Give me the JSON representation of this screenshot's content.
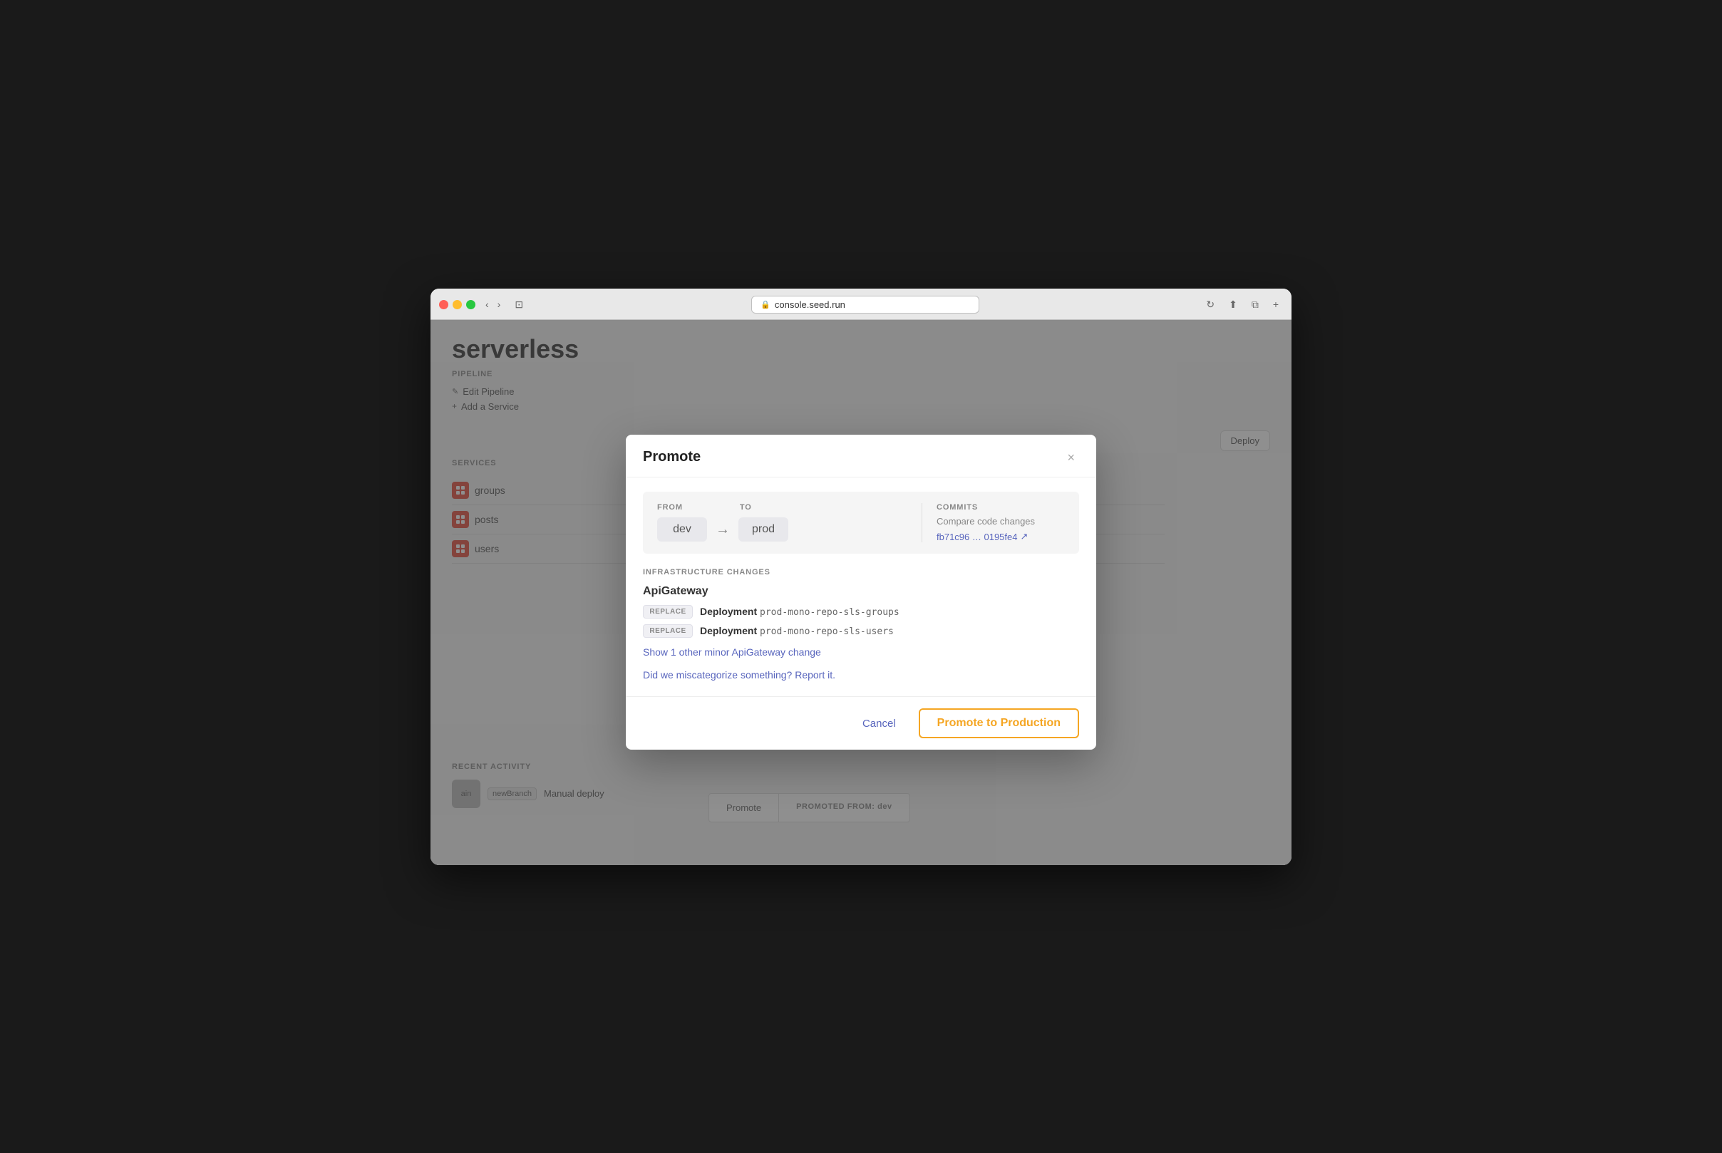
{
  "browser": {
    "url": "console.seed.run",
    "reload_title": "Reload page"
  },
  "background": {
    "page_title": "serverless",
    "pipeline_section": "PIPELINE",
    "edit_pipeline": "Edit Pipeline",
    "add_service": "Add a Service",
    "services_section": "SERVICES",
    "services": [
      {
        "name": "groups"
      },
      {
        "name": "posts"
      },
      {
        "name": "users"
      }
    ],
    "deploy_button": "Deploy",
    "recent_activity_section": "RECENT ACTIVITY",
    "activity_badge": "newBranch",
    "activity_text": "Manual deploy",
    "promoted_from_label": "PROMOTED FROM: dev",
    "promote_label": "Promote"
  },
  "modal": {
    "title": "Promote",
    "close_label": "×",
    "from_label": "FROM",
    "to_label": "TO",
    "from_env": "dev",
    "to_env": "prod",
    "commits_label": "COMMITS",
    "commits_description": "Compare code changes",
    "commits_link": "fb71c96 … 0195fe4",
    "commits_link_icon": "↗",
    "infra_section_title": "INFRASTRUCTURE CHANGES",
    "api_gateway_title": "ApiGateway",
    "changes": [
      {
        "badge": "REPLACE",
        "type": "Deployment",
        "name": "prod-mono-repo-sls-groups"
      },
      {
        "badge": "REPLACE",
        "type": "Deployment",
        "name": "prod-mono-repo-sls-users"
      }
    ],
    "minor_link": "Show 1 other minor ApiGateway change",
    "miscategorize_text": "Did we miscategorize something? Report it.",
    "cancel_label": "Cancel",
    "promote_button_label": "Promote to Production"
  }
}
